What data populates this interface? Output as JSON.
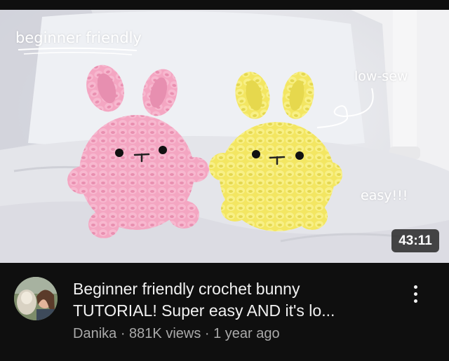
{
  "video": {
    "thumbnail": {
      "overlay_texts": [
        "beginner friendly",
        "low-sew",
        "easy!!!"
      ],
      "duration": "43:11",
      "subjects": [
        "pink-bunny",
        "yellow-bunny"
      ],
      "colors": {
        "pink": "#f4a3c0",
        "yellow": "#f6ea6e"
      }
    },
    "title_line1": "Beginner friendly crochet bunny",
    "title_line2": "TUTORIAL! Super easy AND it's lo...",
    "channel": "Danika",
    "separator": " · ",
    "views": "881K views",
    "age": "1 year ago",
    "more_icon": "three-dots-vertical-icon"
  }
}
